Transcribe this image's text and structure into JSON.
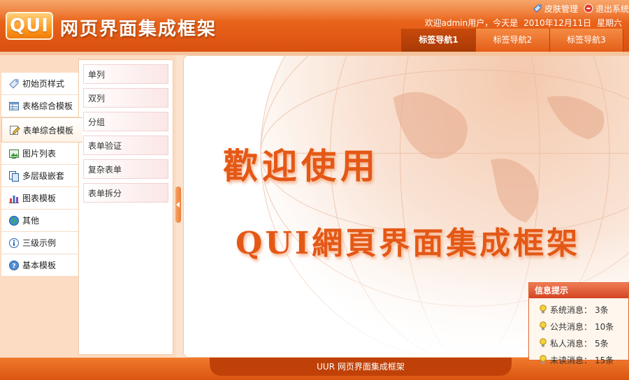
{
  "header": {
    "logo_text": "QUI",
    "title": "网页界面集成框架",
    "links": {
      "skin_label": "皮肤管理",
      "exit_label": "退出系统"
    },
    "welcome_text": "欢迎admin用户，今天是",
    "date_text": "2010年12月11日",
    "weekday_text": "星期六",
    "tabs": [
      {
        "label": "标签导航1",
        "active": true
      },
      {
        "label": "标签导航2",
        "active": false
      },
      {
        "label": "标签导航3",
        "active": false
      }
    ]
  },
  "menu": {
    "items": [
      {
        "label": "初始页样式",
        "icon": "tag-icon"
      },
      {
        "label": "表格综合模板",
        "icon": "table-icon"
      },
      {
        "label": "表单综合模板",
        "icon": "form-edit-icon",
        "active": true
      },
      {
        "label": "图片列表",
        "icon": "image-icon"
      },
      {
        "label": "多层级嵌套",
        "icon": "layers-icon"
      },
      {
        "label": "图表模板",
        "icon": "chart-icon"
      },
      {
        "label": "其他",
        "icon": "globe-icon"
      },
      {
        "label": "三级示例",
        "icon": "info-icon"
      },
      {
        "label": "基本模板",
        "icon": "help-icon"
      }
    ]
  },
  "submenu": {
    "items": [
      "单列",
      "双列",
      "分组",
      "表单验证",
      "复杂表单",
      "表单拆分"
    ]
  },
  "main": {
    "welcome_line1": "歡迎使用",
    "welcome_line2": "QUI網頁界面集成框架"
  },
  "info_box": {
    "title": "信息提示",
    "rows": [
      {
        "label": "系统消息：",
        "value": "3条"
      },
      {
        "label": "公共消息：",
        "value": "10条"
      },
      {
        "label": "私人消息：",
        "value": "5条"
      },
      {
        "label": "未读消息：",
        "value": "15条"
      }
    ]
  },
  "footer": {
    "text": "UUR 网页界面集成框架"
  },
  "colors": {
    "header_orange": "#e9621a",
    "accent_text": "#e45816",
    "panel_bg": "#fcdcc2"
  }
}
